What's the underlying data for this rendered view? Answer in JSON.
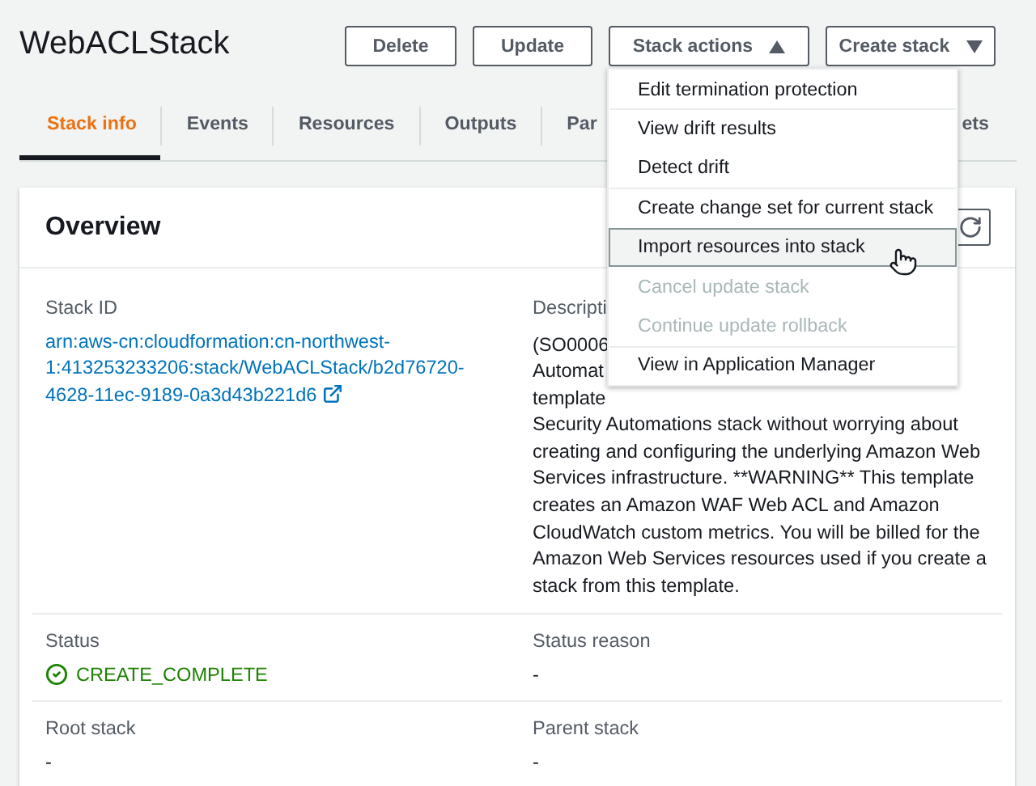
{
  "page": {
    "title": "WebACLStack"
  },
  "header_buttons": [
    {
      "label": "Delete",
      "kind": "plain"
    },
    {
      "label": "Update",
      "kind": "plain"
    },
    {
      "label": "Stack actions",
      "kind": "menu",
      "expanded": true
    },
    {
      "label": "Create stack",
      "kind": "menu",
      "expanded": false
    }
  ],
  "stack_actions_menu": [
    {
      "label": "Edit termination protection",
      "disabled": false,
      "highlighted": false,
      "group_start": false
    },
    {
      "label": "View drift results",
      "disabled": false,
      "highlighted": false,
      "group_start": true
    },
    {
      "label": "Detect drift",
      "disabled": false,
      "highlighted": false,
      "group_start": false
    },
    {
      "label": "Create change set for current stack",
      "disabled": false,
      "highlighted": false,
      "group_start": true
    },
    {
      "label": "Import resources into stack",
      "disabled": false,
      "highlighted": true,
      "group_start": false
    },
    {
      "label": "Cancel update stack",
      "disabled": true,
      "highlighted": false,
      "group_start": false
    },
    {
      "label": "Continue update rollback",
      "disabled": true,
      "highlighted": false,
      "group_start": false
    },
    {
      "label": "View in Application Manager",
      "disabled": false,
      "highlighted": false,
      "group_start": true
    }
  ],
  "tabs": [
    {
      "label": "Stack info",
      "selected": true
    },
    {
      "label": "Events",
      "selected": false
    },
    {
      "label": "Resources",
      "selected": false
    },
    {
      "label": "Outputs",
      "selected": false
    },
    {
      "label": "Par",
      "selected": false
    },
    {
      "label": "ets",
      "selected": false
    }
  ],
  "overview": {
    "title": "Overview",
    "stack_id": {
      "label": "Stack ID",
      "value": "arn:aws-cn:cloudformation:cn-northwest-1:413253233206:stack/WebACLStack/b2d76720-4628-11ec-9189-0a3d43b221d6"
    },
    "description": {
      "label": "Descripti",
      "lines": [
        "(SO0006",
        "Automat",
        "template",
        "Security Automations stack without worrying about",
        "creating and configuring the underlying Amazon Web",
        "Services infrastructure. **WARNING** This template",
        "creates an Amazon WAF Web ACL and Amazon",
        "CloudWatch custom metrics. You will be billed for the",
        "Amazon Web Services resources used if you create a",
        "stack from this template."
      ]
    },
    "fields": [
      {
        "label": "Status",
        "value": "CREATE_COMPLETE",
        "kind": "status"
      },
      {
        "label": "Status reason",
        "value": "-",
        "kind": "text"
      },
      {
        "label": "Root stack",
        "value": "-",
        "kind": "text"
      },
      {
        "label": "Parent stack",
        "value": "-",
        "kind": "text"
      }
    ]
  }
}
